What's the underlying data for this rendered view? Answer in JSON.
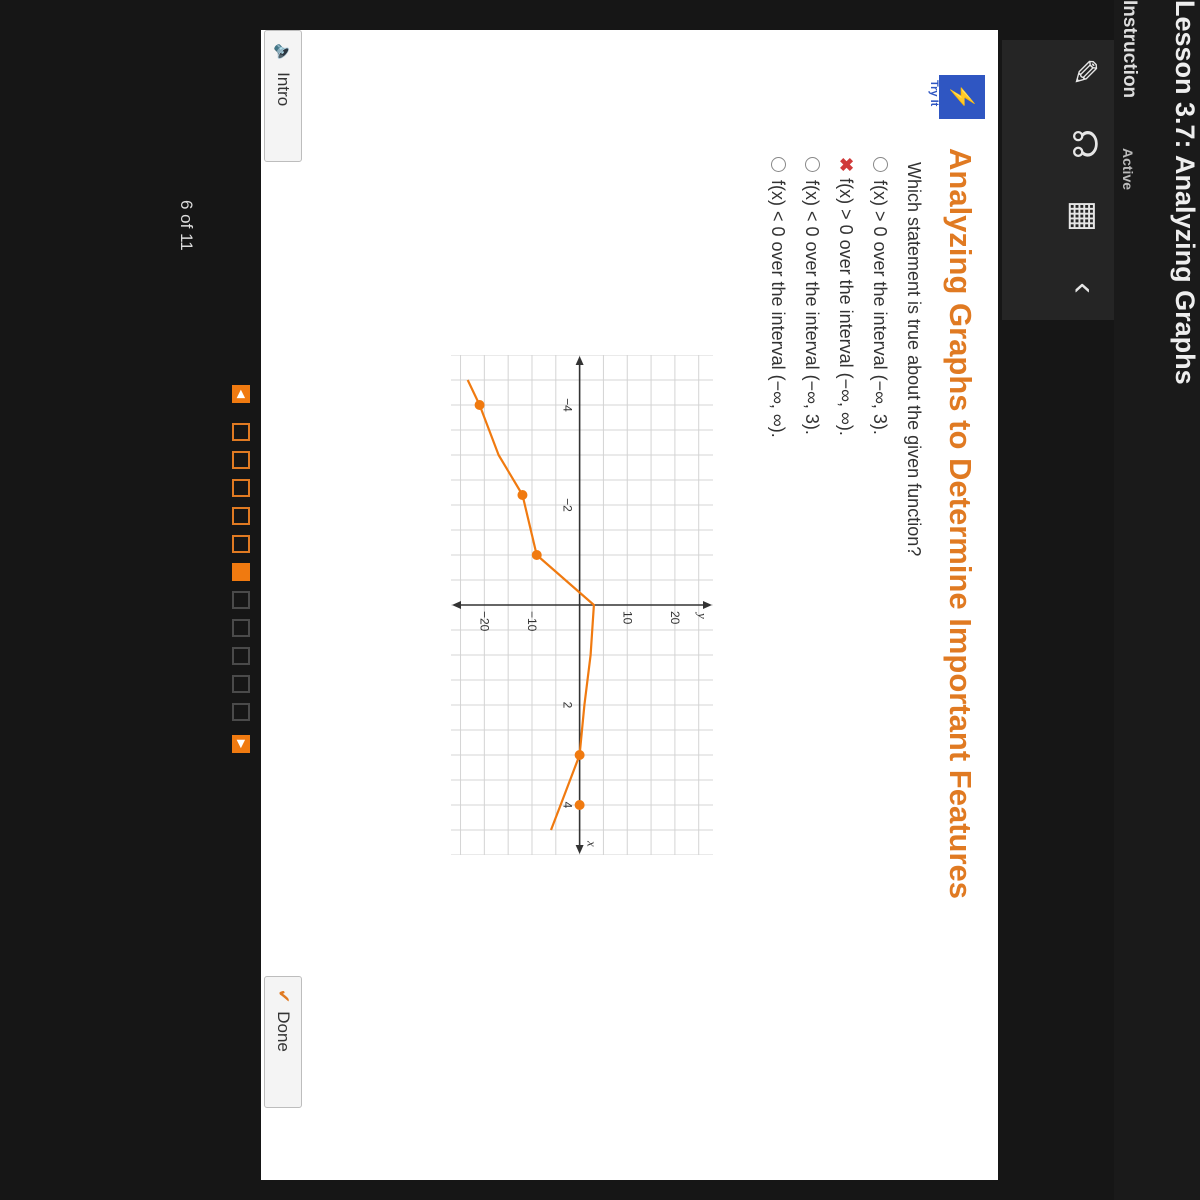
{
  "lesson": {
    "title": "Lesson 3.7: Analyzing Graphs",
    "mode": "Instruction",
    "status": "Active"
  },
  "toolbar": {
    "icons": [
      "pencil-icon",
      "headphones-icon",
      "calculator-icon",
      "collapse-chevron-icon"
    ]
  },
  "panel": {
    "badge_label": "Try It",
    "heading": "Analyzing Graphs to Determine Important Features",
    "question": "Which statement is true about the given function?",
    "options": [
      {
        "text": "f(x) > 0 over the interval (−∞, 3).",
        "state": "unselected"
      },
      {
        "text": "f(x) > 0 over the interval (−∞, ∞).",
        "state": "incorrect"
      },
      {
        "text": "f(x) < 0 over the interval (−∞, 3).",
        "state": "unselected"
      },
      {
        "text": "f(x) < 0 over the interval (−∞, ∞).",
        "state": "unselected"
      }
    ]
  },
  "chart_data": {
    "type": "line",
    "xlabel": "x",
    "ylabel": "y",
    "xlim": [
      -5,
      5
    ],
    "ylim": [
      -27,
      28
    ],
    "x_ticks": [
      -4,
      -2,
      2,
      4
    ],
    "y_ticks": [
      -20,
      -10,
      10,
      20
    ],
    "grid": true,
    "curve_color": "#f07a10",
    "series": [
      {
        "x": [
          -4.5,
          -4,
          -3,
          -2.2,
          -1,
          0,
          1,
          2,
          3,
          4,
          4.5
        ],
        "y": [
          -23.5,
          -21,
          -17,
          -12,
          -9,
          3,
          2.3,
          1,
          0,
          -4,
          -6
        ]
      }
    ],
    "points": [
      {
        "x": -4,
        "y": -21
      },
      {
        "x": -2.2,
        "y": -12
      },
      {
        "x": -1,
        "y": -9
      },
      {
        "x": 3,
        "y": 0
      },
      {
        "x": 4,
        "y": 0
      }
    ]
  },
  "nav": {
    "intro_label": "Intro",
    "done_label": "Done",
    "page_count": "6 of 11",
    "pages_total": 11,
    "current_page": 6,
    "accent": "#f07a10"
  }
}
